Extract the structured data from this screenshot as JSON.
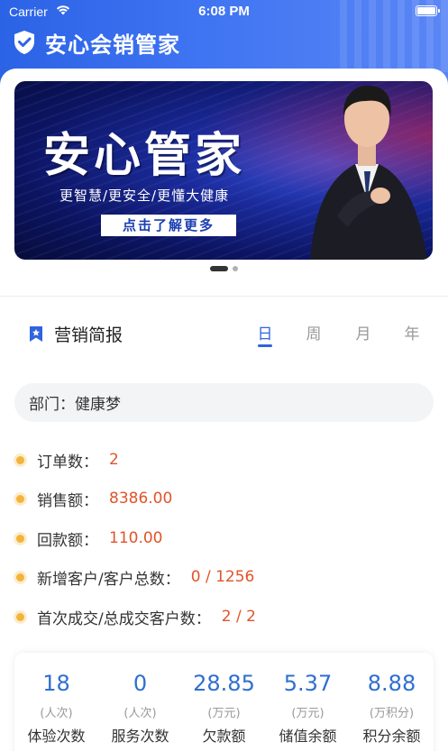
{
  "status_bar": {
    "carrier": "Carrier",
    "time": "6:08 PM"
  },
  "header": {
    "app_title": "安心会销管家"
  },
  "banner": {
    "title": "安心管家",
    "subtitle": "更智慧/更安全/更懂大健康",
    "button_label": "点击了解更多"
  },
  "report": {
    "title": "营销简报",
    "tabs": [
      "日",
      "周",
      "月",
      "年"
    ],
    "active_tab": "日",
    "department": "部门：健康梦",
    "stats": [
      {
        "label": "订单数：",
        "value": "2"
      },
      {
        "label": "销售额：",
        "value": "8386.00"
      },
      {
        "label": "回款额：",
        "value": "110.00"
      },
      {
        "label": "新增客户/客户总数：",
        "value": "0 / 1256"
      },
      {
        "label": "首次成交/总成交客户数：",
        "value": "2 / 2"
      }
    ]
  },
  "summary": [
    {
      "value": "18",
      "unit": "(人次)",
      "label": "体验次数"
    },
    {
      "value": "0",
      "unit": "(人次)",
      "label": "服务次数"
    },
    {
      "value": "28.85",
      "unit": "(万元)",
      "label": "欠款额"
    },
    {
      "value": "5.37",
      "unit": "(万元)",
      "label": "储值余额"
    },
    {
      "value": "8.88",
      "unit": "(万积分)",
      "label": "积分余额"
    }
  ],
  "colors": {
    "header_blue": "#2b63e6",
    "accent_blue": "#2f63e0",
    "value_orange": "#e0542a",
    "bullet_yellow": "#f2b53a",
    "summary_blue": "#2f6fcf"
  }
}
